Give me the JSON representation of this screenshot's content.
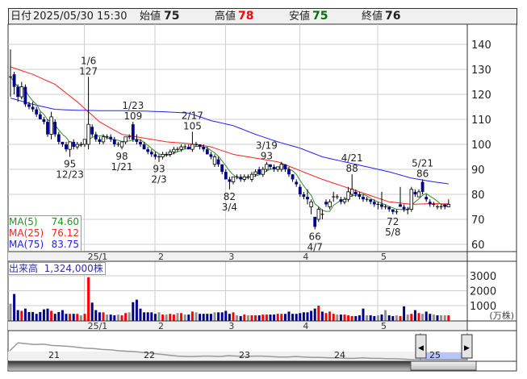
{
  "header": {
    "date_label": "日付",
    "date_value": "2025/05/30 15:30",
    "open_label": "始値",
    "open_value": "75",
    "high_label": "高値",
    "high_value": "78",
    "low_label": "安値",
    "low_value": "75",
    "close_label": "終値",
    "close_value": "76"
  },
  "legend": {
    "ma5_label": "MA(5)",
    "ma5_value": "74.60",
    "ma25_label": "MA(25)",
    "ma25_value": "76.12",
    "ma75_label": "MA(75)",
    "ma75_value": "83.75"
  },
  "volume_legend": {
    "label": "出来高",
    "value": "1,324,000株"
  },
  "colors": {
    "up_fill": "#ffffff",
    "down_fill": "#00008b",
    "ma5": "#2e8b2e",
    "ma25": "#ff2020",
    "ma75": "#2020ff",
    "vol_up": "#ff0000",
    "vol_down": "#00008b",
    "vol_flat": "#909090",
    "high": "#ff0000",
    "low": "#007000"
  },
  "chart_data": {
    "type": "candlestick",
    "price_axis": {
      "ticks": [
        140,
        130,
        120,
        110,
        100,
        90,
        80,
        70,
        60
      ],
      "ylim": [
        58,
        145
      ]
    },
    "volume_axis": {
      "ticks": [
        3000,
        2000,
        1000
      ],
      "unit": "(万株)"
    },
    "month_labels": [
      {
        "label": "25/1",
        "index": 21
      },
      {
        "label": "2",
        "index": 40
      },
      {
        "label": "3",
        "index": 59
      },
      {
        "label": "4",
        "index": 79
      },
      {
        "label": "5",
        "index": 100
      }
    ],
    "candles": [
      [
        127,
        138,
        119,
        127
      ],
      [
        128,
        129,
        120,
        123
      ],
      [
        123,
        124,
        117,
        119
      ],
      [
        119,
        125,
        118,
        123
      ],
      [
        123,
        124,
        115,
        116
      ],
      [
        116,
        117,
        114,
        115
      ],
      [
        115,
        117,
        113,
        114
      ],
      [
        114,
        115,
        111,
        112
      ],
      [
        112,
        113,
        110,
        110
      ],
      [
        110,
        111,
        108,
        109
      ],
      [
        109,
        110,
        103,
        104
      ],
      [
        104,
        113,
        102,
        111
      ],
      [
        109,
        110,
        103,
        104
      ],
      [
        104,
        105,
        100,
        101
      ],
      [
        101,
        101,
        99,
        100
      ],
      [
        100,
        101,
        97,
        98
      ],
      [
        98,
        101,
        95,
        101
      ],
      [
        101,
        102,
        98,
        99
      ],
      [
        99,
        101,
        98,
        100
      ],
      [
        100,
        101,
        99,
        100
      ],
      [
        100,
        102,
        99,
        102
      ],
      [
        100,
        127,
        98,
        108
      ],
      [
        107,
        108,
        103,
        104
      ],
      [
        104,
        105,
        101,
        102
      ],
      [
        102,
        103,
        100,
        101
      ],
      [
        101,
        104,
        100,
        103
      ],
      [
        103,
        104,
        102,
        103
      ],
      [
        103,
        104,
        101,
        102
      ],
      [
        102,
        103,
        99,
        100
      ],
      [
        100,
        101,
        99,
        100
      ],
      [
        99,
        101,
        98,
        101
      ],
      [
        101,
        103,
        100,
        103
      ],
      [
        103,
        104,
        102,
        103
      ],
      [
        108,
        109,
        101,
        102
      ],
      [
        102,
        104,
        100,
        101
      ],
      [
        101,
        102,
        99,
        100
      ],
      [
        100,
        101,
        98,
        98
      ],
      [
        98,
        99,
        96,
        97
      ],
      [
        97,
        98,
        95,
        96
      ],
      [
        96,
        97,
        94,
        95
      ],
      [
        95,
        96,
        93,
        95
      ],
      [
        95,
        97,
        94,
        96
      ],
      [
        96,
        97,
        95,
        96
      ],
      [
        96,
        98,
        95,
        97
      ],
      [
        97,
        99,
        96,
        98
      ],
      [
        98,
        99,
        97,
        98
      ],
      [
        98,
        100,
        97,
        99
      ],
      [
        99,
        100,
        98,
        99
      ],
      [
        99,
        100,
        98,
        98
      ],
      [
        98,
        105,
        97,
        100
      ],
      [
        100,
        101,
        99,
        100
      ],
      [
        100,
        100,
        98,
        99
      ],
      [
        99,
        100,
        97,
        98
      ],
      [
        98,
        99,
        96,
        96
      ],
      [
        96,
        97,
        94,
        95
      ],
      [
        92,
        96,
        91,
        95
      ],
      [
        94,
        95,
        91,
        92
      ],
      [
        92,
        92,
        88,
        89
      ],
      [
        89,
        90,
        86,
        86
      ],
      [
        86,
        87,
        82,
        85
      ],
      [
        85,
        87,
        84,
        87
      ],
      [
        87,
        88,
        86,
        87
      ],
      [
        87,
        88,
        85,
        86
      ],
      [
        86,
        88,
        85,
        87
      ],
      [
        87,
        88,
        86,
        87
      ],
      [
        86,
        89,
        85,
        88
      ],
      [
        88,
        90,
        87,
        89
      ],
      [
        90,
        91,
        88,
        88
      ],
      [
        88,
        91,
        87,
        90
      ],
      [
        90,
        93,
        89,
        92
      ],
      [
        92,
        92,
        90,
        91
      ],
      [
        91,
        92,
        89,
        90
      ],
      [
        90,
        91,
        89,
        91
      ],
      [
        90,
        93,
        89,
        92
      ],
      [
        92,
        92,
        89,
        90
      ],
      [
        90,
        91,
        87,
        88
      ],
      [
        88,
        88,
        85,
        86
      ],
      [
        85,
        86,
        83,
        84
      ],
      [
        83,
        84,
        79,
        80
      ],
      [
        80,
        81,
        78,
        79
      ],
      [
        79,
        82,
        76,
        78
      ],
      [
        75,
        78,
        72,
        77
      ],
      [
        71,
        71,
        66,
        67
      ],
      [
        70,
        75,
        69,
        74
      ],
      [
        72,
        74,
        70,
        72
      ],
      [
        77,
        78,
        75,
        76
      ],
      [
        75,
        78,
        74,
        77
      ],
      [
        79,
        81,
        77,
        79
      ],
      [
        79,
        80,
        78,
        79
      ],
      [
        78,
        79,
        76,
        77
      ],
      [
        77,
        79,
        76,
        78
      ],
      [
        78,
        83,
        77,
        81
      ],
      [
        80,
        88,
        79,
        82
      ],
      [
        81,
        82,
        79,
        80
      ],
      [
        80,
        81,
        78,
        79
      ],
      [
        79,
        80,
        77,
        78
      ],
      [
        78,
        79,
        77,
        78
      ],
      [
        78,
        78,
        76,
        77
      ],
      [
        77,
        78,
        75,
        76
      ],
      [
        76,
        77,
        74,
        76
      ],
      [
        76,
        81,
        74,
        75
      ],
      [
        75,
        76,
        74,
        75
      ],
      [
        75,
        75,
        73,
        74
      ],
      [
        74,
        74,
        72,
        73
      ],
      [
        73,
        74,
        72,
        73
      ],
      [
        76,
        83,
        75,
        75
      ],
      [
        75,
        76,
        73,
        74
      ],
      [
        74,
        75,
        72,
        74
      ],
      [
        74,
        83,
        73,
        82
      ],
      [
        81,
        82,
        79,
        80
      ],
      [
        79,
        82,
        79,
        81
      ],
      [
        85,
        86,
        80,
        81
      ],
      [
        79,
        80,
        77,
        78
      ],
      [
        77,
        78,
        75,
        76
      ],
      [
        76,
        77,
        75,
        76
      ],
      [
        75,
        76,
        74,
        75
      ],
      [
        75,
        76,
        74,
        75
      ],
      [
        76,
        76,
        74,
        75
      ],
      [
        75,
        78,
        75,
        76
      ]
    ],
    "volume": [
      1130,
      1780,
      700,
      650,
      800,
      570,
      570,
      450,
      570,
      750,
      800,
      650,
      450,
      570,
      700,
      450,
      450,
      450,
      450,
      350,
      450,
      2900,
      1200,
      700,
      550,
      550,
      400,
      400,
      350,
      400,
      350,
      500,
      550,
      1230,
      1400,
      800,
      550,
      550,
      550,
      450,
      550,
      400,
      400,
      450,
      400,
      500,
      500,
      400,
      400,
      600,
      550,
      450,
      450,
      450,
      450,
      550,
      550,
      550,
      650,
      450,
      550,
      350,
      300,
      400,
      350,
      350,
      350,
      350,
      400,
      400,
      400,
      400,
      450,
      450,
      450,
      600,
      450,
      450,
      500,
      550,
      550,
      650,
      800,
      1000,
      600,
      500,
      600,
      450,
      400,
      400,
      400,
      350,
      300,
      300,
      350,
      800,
      350,
      350,
      300,
      350,
      400,
      700,
      350,
      300,
      350,
      300,
      950,
      400,
      450,
      700,
      500,
      450,
      600,
      450,
      400,
      350,
      350,
      350,
      350,
      400,
      350
    ],
    "ma25": [
      131,
      128,
      124,
      117,
      109,
      104,
      102.5,
      101,
      100.3,
      99,
      96,
      94.5,
      93,
      89.5,
      86,
      83,
      80,
      77,
      76,
      76.3,
      76.12
    ],
    "ma75": [
      118.5,
      116,
      114,
      113.6,
      113.5,
      113.5,
      113.3,
      113,
      112.5,
      109.5,
      107.5,
      104,
      101,
      98.5,
      95,
      93,
      91,
      89,
      86.5,
      85,
      83.75
    ],
    "ma_sample_step": 6,
    "annotations": [
      {
        "date": "1/6",
        "price": "127",
        "index": 21,
        "pos": "above"
      },
      {
        "date": "12/23",
        "price": "95",
        "index": 16,
        "pos": "below"
      },
      {
        "date": "1/23",
        "price": "109",
        "index": 33,
        "pos": "above"
      },
      {
        "date": "1/21",
        "price": "98",
        "index": 30,
        "pos": "below"
      },
      {
        "date": "2/3",
        "price": "93",
        "index": 40,
        "pos": "below"
      },
      {
        "date": "2/17",
        "price": "105",
        "index": 49,
        "pos": "above"
      },
      {
        "date": "3/4",
        "price": "82",
        "index": 59,
        "pos": "below"
      },
      {
        "date": "3/19",
        "price": "93",
        "index": 69,
        "pos": "above"
      },
      {
        "date": "4/7",
        "price": "66",
        "index": 82,
        "pos": "below"
      },
      {
        "date": "4/21",
        "price": "88",
        "index": 92,
        "pos": "above"
      },
      {
        "date": "5/8",
        "price": "72",
        "index": 103,
        "pos": "below"
      },
      {
        "date": "5/21",
        "price": "86",
        "index": 111,
        "pos": "above"
      }
    ],
    "navigator": {
      "labels": [
        "21",
        "22",
        "23",
        "24",
        "25"
      ],
      "series": [
        72,
        90,
        88,
        86,
        87,
        84,
        83,
        82,
        80,
        78,
        77,
        75,
        74,
        72,
        71,
        70,
        68,
        66,
        64,
        62,
        60,
        59,
        59,
        60,
        60,
        59,
        61,
        60,
        59,
        60,
        60,
        59,
        58,
        58,
        59,
        58,
        57,
        57,
        56,
        56,
        55,
        55,
        56,
        55,
        55,
        54,
        54,
        53,
        52
      ]
    }
  }
}
